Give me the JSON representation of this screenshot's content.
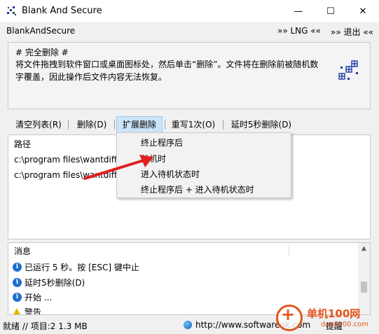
{
  "window": {
    "title": "Blank And Secure",
    "minimize_glyph": "—",
    "maximize_glyph": "☐",
    "close_glyph": "✕"
  },
  "menubar": {
    "app_name": "BlankAndSecure",
    "lng": "»» LNG ««",
    "exit": "»» 退出 ««"
  },
  "info": {
    "title": "# 完全删除 #",
    "description": "将文件拖拽到软件窗口或桌面图标处，然后单击“删除”。文件将在删除前被随机数字覆盖，因此操作后文件内容无法恢复。"
  },
  "toolbar": {
    "clear": "清空列表(R)",
    "delete": "删除(D)",
    "extended_delete": "扩展删除",
    "overwrite": "重写1次(O)",
    "delay": "延时5秒删除(D)"
  },
  "dropdown": {
    "items": [
      "终止程序后",
      "关机时",
      "进入待机状态时",
      "终止程序后 + 进入待机状态时"
    ]
  },
  "filelist": {
    "header": "路径",
    "rows": [
      "c:\\program files\\wantdiff",
      "c:\\program files\\wantdiff"
    ]
  },
  "messages": {
    "header": "消息",
    "rows": [
      "已运行 5 秒。按 [ESC] 键中止",
      "延时5秒删除(D)",
      "开始 ...",
      "警告"
    ]
  },
  "statusbar": {
    "text": "就绪 // 项目:2 1.3 MB",
    "url": "http://www.softwareok.com",
    "note": "提醒"
  },
  "watermark": {
    "title": "单机100网",
    "url": "danji100.com"
  },
  "colors": {
    "accent_highlight": "#cce4f7",
    "arrow": "#e02020",
    "info_icon": "#1f6fd0",
    "watermark": "#e5541b"
  }
}
